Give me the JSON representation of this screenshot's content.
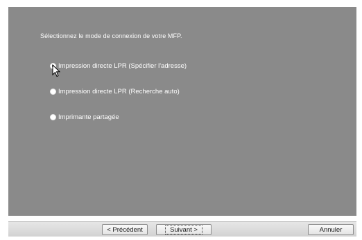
{
  "wizard": {
    "prompt": "Sélectionnez le mode de connexion de votre MFP.",
    "options": [
      {
        "label": "Impression directe LPR (Spécifier l'adresse)",
        "selected": true
      },
      {
        "label": "Impression directe LPR (Recherche auto)",
        "selected": false
      },
      {
        "label": "Imprimante partagée",
        "selected": false
      }
    ]
  },
  "buttons": {
    "back": "< Précédent",
    "next": "Suivant >",
    "cancel": "Annuler"
  },
  "colors": {
    "panel": "#8a8a8a",
    "text": "#ffffff"
  },
  "icons": {
    "pointer": "mouse-pointer-icon"
  }
}
